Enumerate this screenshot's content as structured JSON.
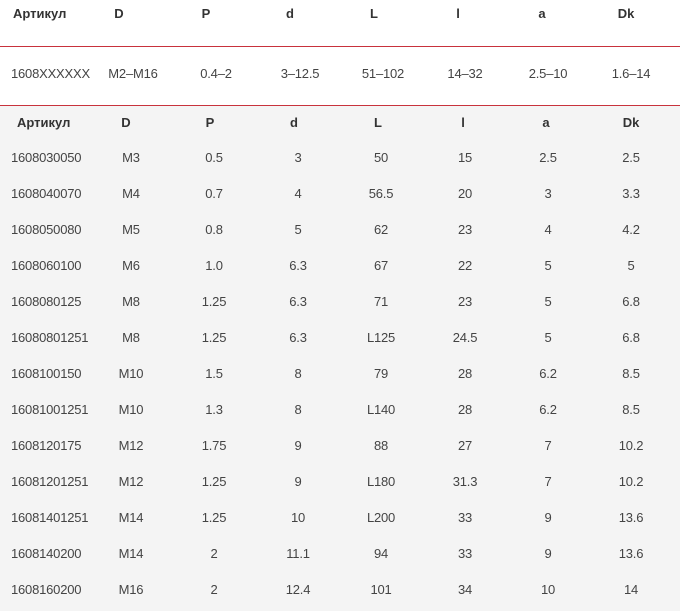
{
  "summary": {
    "headers": [
      "Артикул",
      "D",
      "P",
      "d",
      "L",
      "l",
      "a",
      "Dk"
    ],
    "row": [
      "1608XXXXXX",
      "M2–M16",
      "0.4–2",
      "3–12.5",
      "51–102",
      "14–32",
      "2.5–10",
      "1.6–14"
    ]
  },
  "detail": {
    "headers": [
      "Артикул",
      "D",
      "P",
      "d",
      "L",
      "l",
      "a",
      "Dk"
    ],
    "rows": [
      [
        "1608030050",
        "M3",
        "0.5",
        "3",
        "50",
        "15",
        "2.5",
        "2.5"
      ],
      [
        "1608040070",
        "M4",
        "0.7",
        "4",
        "56.5",
        "20",
        "3",
        "3.3"
      ],
      [
        "1608050080",
        "M5",
        "0.8",
        "5",
        "62",
        "23",
        "4",
        "4.2"
      ],
      [
        "1608060100",
        "M6",
        "1.0",
        "6.3",
        "67",
        "22",
        "5",
        "5"
      ],
      [
        "1608080125",
        "M8",
        "1.25",
        "6.3",
        "71",
        "23",
        "5",
        "6.8"
      ],
      [
        "16080801251",
        "M8",
        "1.25",
        "6.3",
        "L125",
        "24.5",
        "5",
        "6.8"
      ],
      [
        "1608100150",
        "M10",
        "1.5",
        "8",
        "79",
        "28",
        "6.2",
        "8.5"
      ],
      [
        "16081001251",
        "M10",
        "1.3",
        "8",
        "L140",
        "28",
        "6.2",
        "8.5"
      ],
      [
        "1608120175",
        "M12",
        "1.75",
        "9",
        "88",
        "27",
        "7",
        "10.2"
      ],
      [
        "16081201251",
        "M12",
        "1.25",
        "9",
        "L180",
        "31.3",
        "7",
        "10.2"
      ],
      [
        "16081401251",
        "M14",
        "1.25",
        "10",
        "L200",
        "33",
        "9",
        "13.6"
      ],
      [
        "1608140200",
        "M14",
        "2",
        "11.1",
        "94",
        "33",
        "9",
        "13.6"
      ],
      [
        "1608160200",
        "M16",
        "2",
        "12.4",
        "101",
        "34",
        "10",
        "14"
      ]
    ]
  }
}
